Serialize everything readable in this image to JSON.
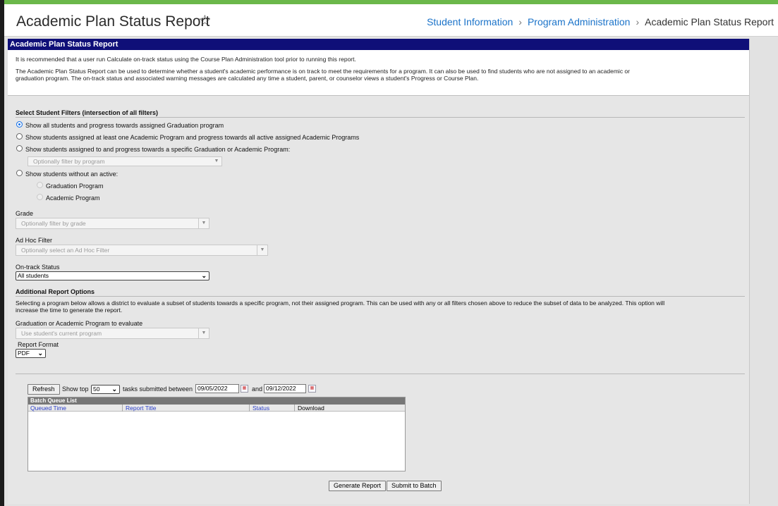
{
  "header": {
    "title": "Academic Plan Status Report",
    "star_icon": "☆",
    "breadcrumb": [
      "Student Information",
      "Program Administration",
      "Academic Plan Status Report"
    ],
    "breadcrumb_sep": "›"
  },
  "section": {
    "title": "Academic Plan Status Report",
    "intro_1": "It is recommended that a user run Calculate on-track status using the Course Plan Administration tool prior to running this report.",
    "intro_2a": "The Academic Plan Status Report can be used to determine whether a student's academic performance is on track to meet the requirements for a program. It can also be used to find students who are not assigned to an academic or",
    "intro_2b": "graduation program. The on-track status and associated warning messages are calculated any time a student, parent, or counselor views a student's Progress or Course Plan."
  },
  "filters": {
    "heading": "Select Student Filters (intersection of all filters)",
    "option_1": "Show all students and progress towards assigned Graduation program",
    "option_2": "Show students assigned at least one Academic Program and progress towards all active assigned Academic Programs",
    "option_3": "Show students assigned to and progress towards a specific Graduation or Academic Program:",
    "program_placeholder": "Optionally filter by program",
    "option_4": "Show students without an active:",
    "sub_option_1": "Graduation Program",
    "sub_option_2": "Academic Program",
    "selected_option": 1
  },
  "grade": {
    "label": "Grade",
    "placeholder": "Optionally filter by grade"
  },
  "adhoc": {
    "label": "Ad Hoc Filter",
    "placeholder": "Optionally select an Ad Hoc Filter"
  },
  "ontrack": {
    "label": "On-track Status",
    "value": "All students"
  },
  "additional": {
    "heading": "Additional Report Options",
    "desc_1": "Selecting a program below allows a district to evaluate a subset of students towards a specific program, not their assigned program. This can be used with any or all filters chosen above to reduce the subset of data to be analyzed. This option will",
    "desc_2": "increase the time to generate the report.",
    "program_label": "Graduation or Academic Program to evaluate",
    "program_placeholder": "Use student's current program",
    "format_label": "Report Format",
    "format_value": "PDF"
  },
  "batch": {
    "refresh": "Refresh",
    "show_top": "Show top",
    "top_value": "50",
    "submitted_between": "tasks submitted between",
    "start_date": "09/05/2022",
    "and": "and",
    "end_date": "09/12/2022",
    "title": "Batch Queue List",
    "columns": [
      "Queued Time",
      "Report Title",
      "Status",
      "Download"
    ]
  },
  "actions": {
    "generate": "Generate Report",
    "submit": "Submit to Batch"
  },
  "colors": {
    "accent_bar": "#0f0f78",
    "link": "#1b73c9",
    "frame_top": "#6bb84a"
  }
}
